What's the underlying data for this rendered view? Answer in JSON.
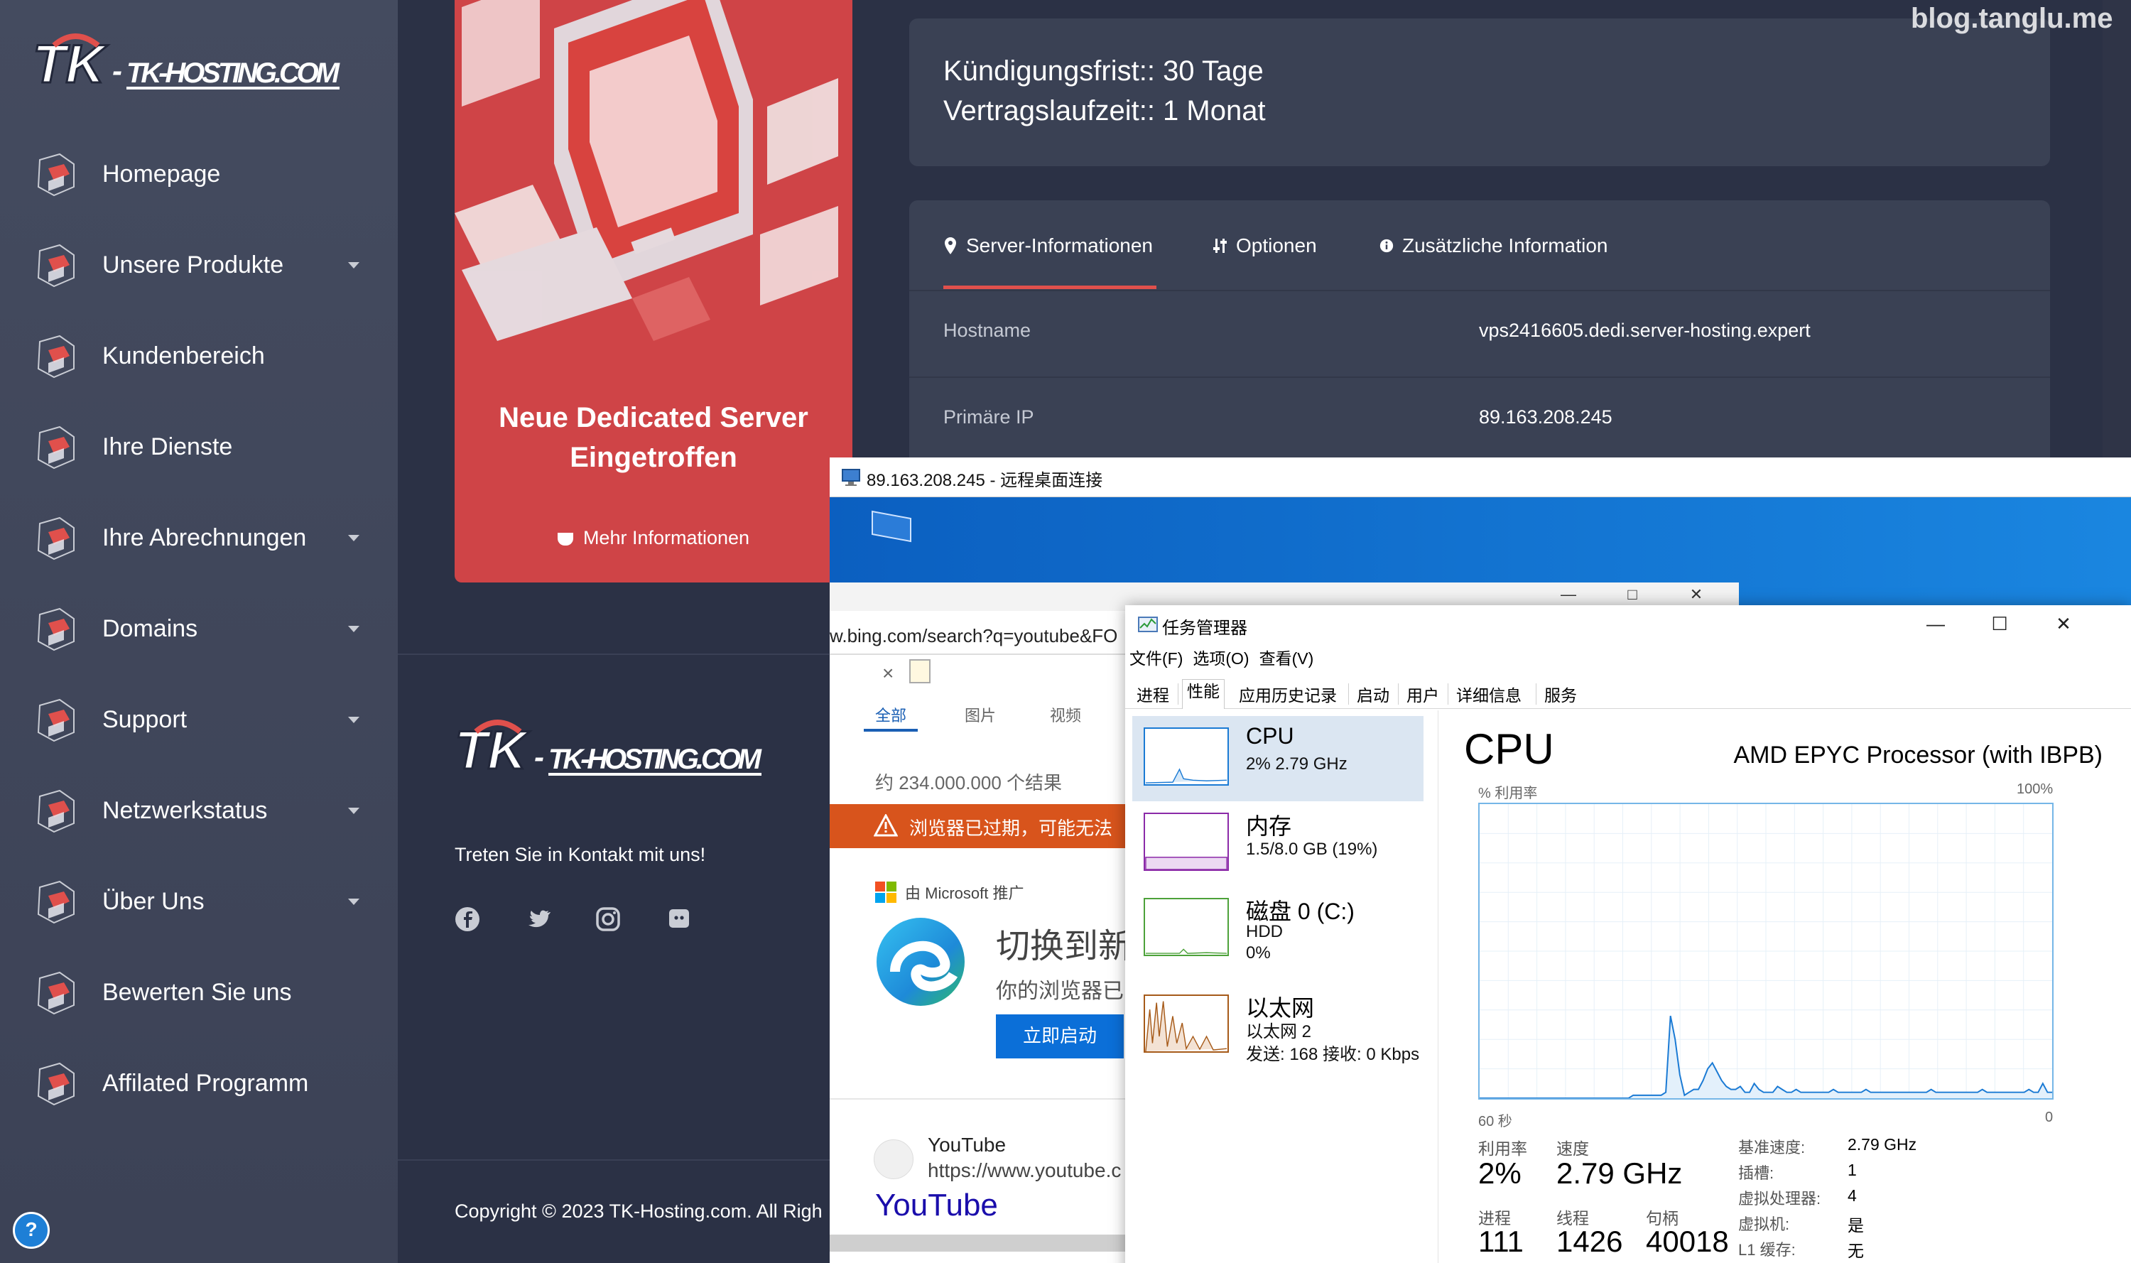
{
  "brand": {
    "logo_text": "TK-HOSTING.COM",
    "accent": "#e0504c"
  },
  "sidebar": {
    "items": [
      {
        "label": "Homepage",
        "icon": "home-icon",
        "has_caret": false
      },
      {
        "label": "Unsere Produkte",
        "icon": "box-icon",
        "has_caret": true
      },
      {
        "label": "Kundenbereich",
        "icon": "customer-area-icon",
        "has_caret": false
      },
      {
        "label": "Ihre Dienste",
        "icon": "services-icon",
        "has_caret": false
      },
      {
        "label": "Ihre Abrechnungen",
        "icon": "invoice-icon",
        "has_caret": true
      },
      {
        "label": "Domains",
        "icon": "globe-icon",
        "has_caret": true
      },
      {
        "label": "Support",
        "icon": "support-icon",
        "has_caret": true
      },
      {
        "label": "Netzwerkstatus",
        "icon": "network-icon",
        "has_caret": true
      },
      {
        "label": "Über Uns",
        "icon": "cube-icon",
        "has_caret": true
      },
      {
        "label": "Bewerten Sie uns",
        "icon": "rating-icon",
        "has_caret": false
      },
      {
        "label": "Affilated Programm",
        "icon": "chart-icon",
        "has_caret": false
      }
    ]
  },
  "banner": {
    "title_line1": "Neue Dedicated Server",
    "title_line2": "Eingetroffen",
    "more": "Mehr Informationen"
  },
  "contract": {
    "notice": "Kündigungsfrist:: 30 Tage",
    "term": "Vertragslaufzeit:: 1 Monat"
  },
  "server_info": {
    "tabs": [
      {
        "label": "Server-Informationen",
        "icon": "map-pin-icon"
      },
      {
        "label": "Optionen",
        "icon": "sliders-icon"
      },
      {
        "label": "Zusätzliche Information",
        "icon": "info-icon"
      }
    ],
    "rows": [
      {
        "key": "Hostname",
        "value": "vps2416605.dedi.server-hosting.expert"
      },
      {
        "key": "Primäre IP",
        "value": "89.163.208.245"
      }
    ]
  },
  "footer": {
    "contact": "Treten Sie in Kontakt mit uns!",
    "social": [
      "facebook-icon",
      "twitter-icon",
      "instagram-icon",
      "discord-icon"
    ],
    "copyright": "Copyright © 2023 TK-Hosting.com. All Righ"
  },
  "watermark": "blog.tanglu.me",
  "rdp": {
    "title": "89.163.208.245 - 远程桌面连接",
    "browser": {
      "url": "w.bing.com/search?q=youtube&FO",
      "close_tab": "×",
      "tabs": [
        "全部",
        "图片",
        "视频"
      ],
      "result_count": "约 234.000.000 个结果",
      "warning": "浏览器已过期，可能无法",
      "ad_label": "由 Microsoft 推广",
      "headline": "切换到新",
      "subline": "你的浏览器已",
      "launch_button": "立即启动",
      "result_name": "YouTube",
      "result_url": "https://www.youtube.c",
      "result_link": "YouTube"
    },
    "taskmgr": {
      "title": "任务管理器",
      "menu": [
        "文件(F)",
        "选项(O)",
        "查看(V)"
      ],
      "tabs": [
        "进程",
        "性能",
        "应用历史记录",
        "启动",
        "用户",
        "详细信息",
        "服务"
      ],
      "active_tab": "性能",
      "resources": [
        {
          "name": "CPU",
          "sub1": "2% 2.79 GHz",
          "sub2": "",
          "color": "#1a7ad4"
        },
        {
          "name": "内存",
          "sub1": "1.5/8.0 GB (19%)",
          "sub2": "",
          "color": "#8b2aa8"
        },
        {
          "name": "磁盘 0 (C:)",
          "sub1": "HDD",
          "sub2": "0%",
          "color": "#4da23a"
        },
        {
          "name": "以太网",
          "sub1": "以太网 2",
          "sub2": "发送: 168 接收: 0 Kbps",
          "color": "#a65a19"
        }
      ],
      "cpu": {
        "heading": "CPU",
        "model": "AMD EPYC Processor (with IBPB)",
        "y_label": "% 利用率",
        "y_max": "100%",
        "x_left": "60 秒",
        "x_right": "0",
        "history": [
          0,
          0,
          0,
          0,
          0,
          0,
          0,
          0,
          0,
          0,
          0,
          0,
          0,
          0,
          0,
          0,
          0,
          0,
          0,
          0,
          0,
          0,
          0,
          0,
          0,
          0,
          0,
          0,
          0,
          0,
          0,
          0,
          0,
          1,
          1,
          1,
          1,
          1,
          1,
          1,
          2,
          28,
          20,
          8,
          1,
          2,
          3,
          3,
          6,
          10,
          12,
          9,
          6,
          4,
          3,
          3,
          4,
          2,
          2,
          5,
          3,
          2,
          2,
          2,
          4,
          3,
          2,
          2,
          3,
          2,
          2,
          2,
          2,
          2,
          2,
          2,
          3,
          2,
          2,
          2,
          2,
          2,
          2,
          3,
          2,
          2,
          2,
          2,
          2,
          2,
          2,
          2,
          2,
          2,
          2,
          2,
          2,
          3,
          2,
          2,
          2,
          2,
          2,
          2,
          2,
          2,
          2,
          2,
          3,
          2,
          2,
          2,
          2,
          2,
          2,
          2,
          2,
          2,
          3,
          2,
          2,
          5,
          2,
          2
        ],
        "utilization_label": "利用率",
        "utilization": "2%",
        "speed_label": "速度",
        "speed": "2.79 GHz",
        "processes_label": "进程",
        "processes": "111",
        "threads_label": "线程",
        "threads": "1426",
        "handles_label": "句柄",
        "handles": "40018",
        "details": [
          {
            "key": "基准速度:",
            "value": "2.79 GHz"
          },
          {
            "key": "插槽:",
            "value": "1"
          },
          {
            "key": "虚拟处理器:",
            "value": "4"
          },
          {
            "key": "虚拟机:",
            "value": "是"
          },
          {
            "key": "L1 缓存:",
            "value": "无"
          }
        ]
      }
    }
  }
}
